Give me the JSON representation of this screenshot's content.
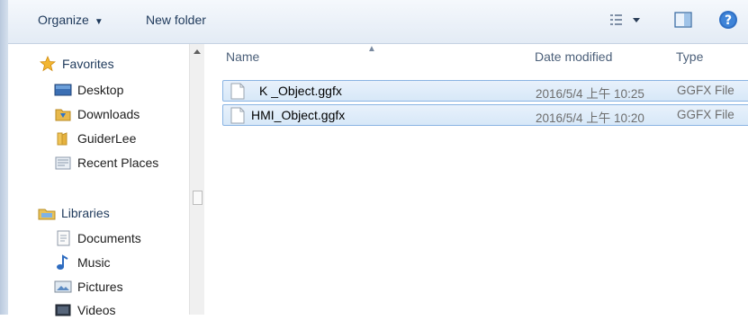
{
  "toolbar": {
    "organize_label": "Organize",
    "new_folder_label": "New folder"
  },
  "nav": {
    "favorites": {
      "label": "Favorites",
      "items": [
        {
          "label": "Desktop",
          "icon": "desktop-icon"
        },
        {
          "label": "Downloads",
          "icon": "downloads-folder-icon"
        },
        {
          "label": "GuiderLee",
          "icon": "user-folder-icon"
        },
        {
          "label": "Recent Places",
          "icon": "recent-places-icon"
        }
      ]
    },
    "libraries": {
      "label": "Libraries",
      "items": [
        {
          "label": "Documents",
          "icon": "documents-icon"
        },
        {
          "label": "Music",
          "icon": "music-icon"
        },
        {
          "label": "Pictures",
          "icon": "pictures-icon"
        },
        {
          "label": "Videos",
          "icon": "videos-icon"
        }
      ]
    }
  },
  "columns": {
    "name": "Name",
    "date_modified": "Date modified",
    "type": "Type"
  },
  "files": [
    {
      "name": "K _Object.ggfx",
      "date": "2016/5/4 上午 10:25",
      "type": "GGFX File"
    },
    {
      "name": "HMI_Object.ggfx",
      "date": "2016/5/4 上午 10:20",
      "type": "GGFX File"
    }
  ],
  "colors": {
    "selection_fill": "#dbe9f8",
    "selection_border": "#8ab4e3",
    "text": "#1e395b"
  }
}
